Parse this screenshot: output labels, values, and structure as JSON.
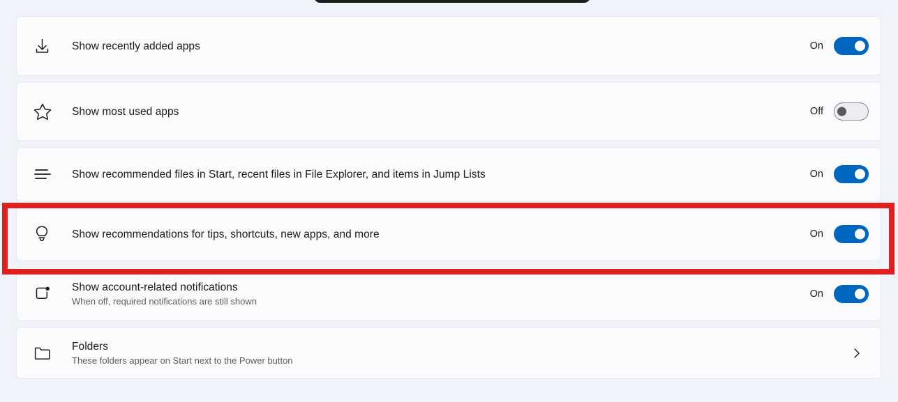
{
  "page": {
    "background_color": "#f0f3f9",
    "card_color": "#fbfbfd",
    "accent_color": "#0067c0",
    "highlight_color": "#e02020"
  },
  "settings": [
    {
      "icon": "download-icon",
      "primary": "Show recently added apps",
      "secondary": "",
      "control": "toggle",
      "state_label": "On",
      "state": "on",
      "highlighted": false
    },
    {
      "icon": "star-icon",
      "primary": "Show most used apps",
      "secondary": "",
      "control": "toggle",
      "state_label": "Off",
      "state": "off",
      "highlighted": false
    },
    {
      "icon": "list-lines-icon",
      "primary": "Show recommended files in Start, recent files in File Explorer, and items in Jump Lists",
      "secondary": "",
      "control": "toggle",
      "state_label": "On",
      "state": "on",
      "highlighted": false
    },
    {
      "icon": "lightbulb-icon",
      "primary": "Show recommendations for tips, shortcuts, new apps, and more",
      "secondary": "",
      "control": "toggle",
      "state_label": "On",
      "state": "on",
      "highlighted": true
    },
    {
      "icon": "notification-badge-icon",
      "primary": "Show account-related notifications",
      "secondary": "When off, required notifications are still shown",
      "control": "toggle",
      "state_label": "On",
      "state": "on",
      "highlighted": false
    },
    {
      "icon": "folder-icon",
      "primary": "Folders",
      "secondary": "These folders appear on Start next to the Power button",
      "control": "chevron",
      "state_label": "",
      "state": "",
      "highlighted": false
    }
  ]
}
